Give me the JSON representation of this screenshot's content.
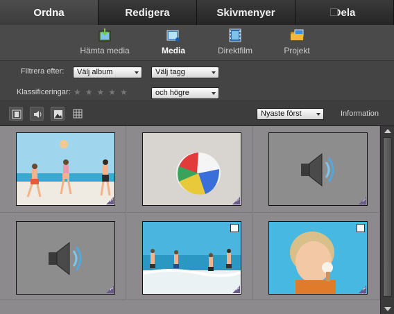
{
  "tabs": [
    {
      "label": "Ordna",
      "active": true
    },
    {
      "label": "Redigera",
      "active": false
    },
    {
      "label": "Skivmenyer",
      "active": false
    },
    {
      "label": "Dela",
      "active": false
    }
  ],
  "subnav": [
    {
      "label": "Hämta media",
      "icon": "download-media-icon",
      "active": false
    },
    {
      "label": "Media",
      "icon": "media-icon",
      "active": true
    },
    {
      "label": "Direktfilm",
      "icon": "film-icon",
      "active": false
    },
    {
      "label": "Projekt",
      "icon": "folder-icon",
      "active": false
    }
  ],
  "filters": {
    "filter_label": "Filtrera efter:",
    "album_select": "Välj album",
    "tag_select": "Välj tagg",
    "rating_label": "Klassificeringar:",
    "rating_stars": "★★★★★",
    "rating_select": "och högre"
  },
  "toolbar": {
    "sort_select": "Nyaste först",
    "info_label": "Information",
    "buttons": [
      "film-filter-icon",
      "audio-filter-icon",
      "photo-filter-icon",
      "grid-view-icon"
    ]
  },
  "grid": {
    "items": [
      {
        "type": "photo",
        "subject": "children-beach"
      },
      {
        "type": "photo",
        "subject": "beach-ball"
      },
      {
        "type": "audio"
      },
      {
        "type": "audio"
      },
      {
        "type": "photo",
        "subject": "boys-surf"
      },
      {
        "type": "photo",
        "subject": "boy-icecream"
      }
    ],
    "badge_label": "P"
  },
  "colors": {
    "grid_bg": "#8c8a8d",
    "sky": "#7fc6e6",
    "sea": "#3aa7c9",
    "sand": "#efe9df"
  }
}
